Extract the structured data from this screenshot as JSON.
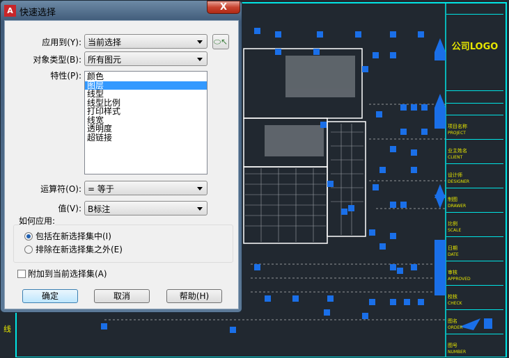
{
  "dialog": {
    "title": "快速选择",
    "close_label": "X",
    "apply_to": {
      "label": "应用到(Y):",
      "value": "当前选择"
    },
    "object_type": {
      "label": "对象类型(B):",
      "value": "所有图元"
    },
    "properties": {
      "label": "特性(P):",
      "items": [
        "颜色",
        "图层",
        "线型",
        "线型比例",
        "打印样式",
        "线宽",
        "透明度",
        "超链接"
      ],
      "selected": 1
    },
    "operator": {
      "label": "运算符(O):",
      "value": "= 等于"
    },
    "value": {
      "label": "值(V):",
      "value": "B标注"
    },
    "how_to_apply": {
      "label": "如何应用:",
      "options": [
        "包括在新选择集中(I)",
        "排除在新选择集之外(E)"
      ],
      "selected": 0
    },
    "append_label": "附加到当前选择集(A)",
    "ok_label": "确定",
    "cancel_label": "取消",
    "help_label": "帮助(H)"
  },
  "title_block": {
    "logo": "公司LOGO",
    "rows": [
      {
        "cn": "项目名称",
        "en": "PROJECT"
      },
      {
        "cn": "业主姓名",
        "en": "CLIENT"
      },
      {
        "cn": "设计师",
        "en": "DESIGNER"
      },
      {
        "cn": "制图",
        "en": "DRAWER"
      },
      {
        "cn": "比例",
        "en": "SCALE"
      },
      {
        "cn": "日期",
        "en": "DATE"
      },
      {
        "cn": "审核",
        "en": "APPROVED"
      },
      {
        "cn": "校核",
        "en": "CHECK"
      },
      {
        "cn": "图名",
        "en": "ORDER"
      },
      {
        "cn": "图号",
        "en": "NUMBER"
      }
    ]
  },
  "left_edge_text": "线",
  "colors": {
    "accent": "#3399ff",
    "grip": "#1a6fe8",
    "frame": "#00e5e5",
    "annotation": "#e03a2a"
  }
}
